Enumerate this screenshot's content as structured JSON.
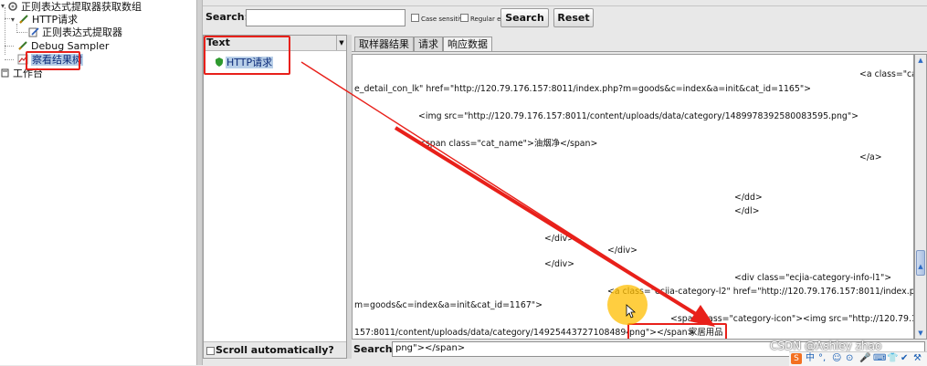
{
  "tree": {
    "root_label": "正则表达式提取器获取数组",
    "http_label": "HTTP请求",
    "extractor_label": "正则表达式提取器",
    "debug_label": "Debug Sampler",
    "tree_listener_label": "察看结果树",
    "workbench_label": "工作台"
  },
  "search": {
    "label": "Search:",
    "value": "",
    "case_label": "Case sensitive",
    "regex_label": "Regular exp.",
    "search_button": "Search",
    "reset_button": "Reset"
  },
  "list": {
    "renderer": "Text",
    "item": "HTTP请求",
    "scroll_label": "Scroll automatically?"
  },
  "tabs": [
    "取样器结果",
    "请求",
    "响应数据"
  ],
  "content_lines": [
    "<a class=\"cat",
    "e_detail_con_lk\" href=\"http://120.79.176.157:8011/index.php?m=goods&c=index&a=init&cat_id=1165\">",
    "<img src=\"http://120.79.176.157:8011/content/uploads/data/category/1489978392580083595.png\">",
    "<span class=\"cat_name\">油烟净</span>",
    "</a>",
    "</dd>",
    "</dl>",
    "</div>",
    "</div>",
    "</div>",
    "<div class=\"ecjia-category-info-l1\">",
    "<a class=\"ecjia-category-l2\" href=\"http://120.79.176.157:8011/index.php?",
    "m=goods&c=index&a=init&cat_id=1167\">",
    "<span class=\"category-icon\"><img src=\"http://120.79.176.",
    "157:8011/content/uploads/data/category/1492544372710848948",
    "png\"></span>",
    "家居用品"
  ],
  "bottom_search": {
    "label": "Search:",
    "value": "png\"></span>"
  },
  "watermark": "CSDN @Ashley zhao",
  "ime": [
    "中",
    "°,",
    "☺",
    "⊙",
    "🎤",
    "⌨",
    "👕",
    "✔",
    "⚒"
  ],
  "colors": {
    "annotation_red": "#e8201a",
    "selection_blue": "#b8cfe8"
  }
}
